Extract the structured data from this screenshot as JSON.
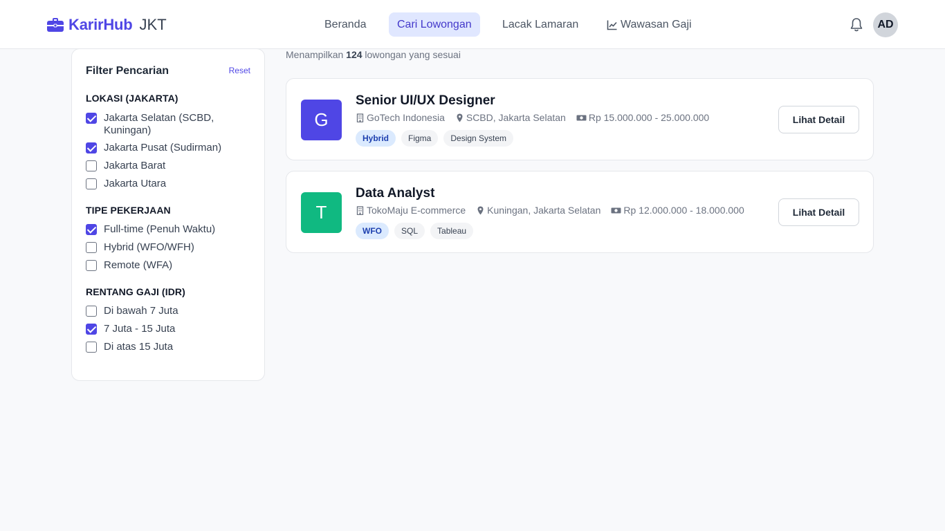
{
  "brand": {
    "name": "KarirHub",
    "suffix": "JKT",
    "color": "#4f46e5"
  },
  "nav": {
    "items": [
      {
        "label": "Beranda",
        "active": false
      },
      {
        "label": "Cari Lowongan",
        "active": true
      },
      {
        "label": "Lacak Lamaran",
        "active": false
      },
      {
        "label": "Wawasan Gaji",
        "active": false,
        "icon": "chart-line-icon"
      }
    ]
  },
  "user": {
    "initials": "AD",
    "notification_icon": "bell-icon"
  },
  "filters": {
    "title": "Filter Pencarian",
    "reset_label": "Reset",
    "sections": [
      {
        "title": "LOKASI (JAKARTA)",
        "options": [
          {
            "label": "Jakarta Selatan (SCBD, Kuningan)",
            "checked": true
          },
          {
            "label": "Jakarta Pusat (Sudirman)",
            "checked": true
          },
          {
            "label": "Jakarta Barat",
            "checked": false
          },
          {
            "label": "Jakarta Utara",
            "checked": false
          }
        ]
      },
      {
        "title": "TIPE PEKERJAAN",
        "options": [
          {
            "label": "Full-time (Penuh Waktu)",
            "checked": true
          },
          {
            "label": "Hybrid (WFO/WFH)",
            "checked": false
          },
          {
            "label": "Remote (WFA)",
            "checked": false
          }
        ]
      },
      {
        "title": "RENTANG GAJI (IDR)",
        "options": [
          {
            "label": "Di bawah 7 Juta",
            "checked": false
          },
          {
            "label": "7 Juta - 15 Juta",
            "checked": true
          },
          {
            "label": "Di atas 15 Juta",
            "checked": false
          }
        ]
      }
    ]
  },
  "results": {
    "prefix": "Menampilkan",
    "count": "124",
    "suffix": "lowongan yang sesuai"
  },
  "jobs": [
    {
      "logo_letter": "G",
      "logo_color": "#4f46e5",
      "title": "Senior UI/UX Designer",
      "company": "GoTech Indonesia",
      "location": "SCBD, Jakarta Selatan",
      "salary": "Rp 15.000.000 - 25.000.000",
      "tags": [
        "Hybrid",
        "Figma",
        "Design System"
      ],
      "action": "Lihat Detail"
    },
    {
      "logo_letter": "T",
      "logo_color": "#10b981",
      "title": "Data Analyst",
      "company": "TokoMaju E-commerce",
      "location": "Kuningan, Jakarta Selatan",
      "salary": "Rp 12.000.000 - 18.000.000",
      "tags": [
        "WFO",
        "SQL",
        "Tableau"
      ],
      "action": "Lihat Detail"
    }
  ]
}
